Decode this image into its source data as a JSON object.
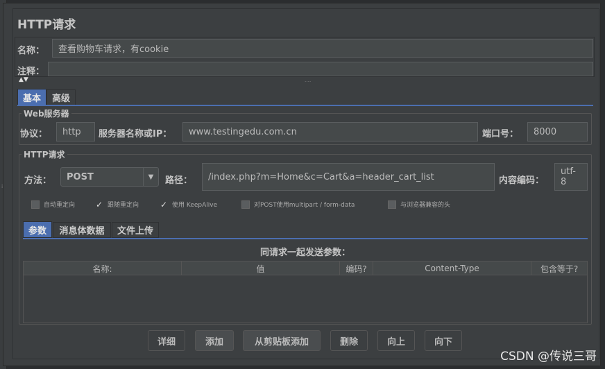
{
  "panel_title": "HTTP请求",
  "name_label": "名称：",
  "name_value": "查看购物车请求，有cookie",
  "comment_label": "注释：",
  "comment_value": "",
  "tabs": [
    {
      "label": "基本",
      "active": true
    },
    {
      "label": "高级",
      "active": false
    }
  ],
  "web_server": {
    "group_label": "Web服务器",
    "protocol_label": "协议：",
    "protocol_value": "http",
    "server_label": "服务器名称或IP：",
    "server_value": "www.testingedu.com.cn",
    "port_label": "端口号：",
    "port_value": "8000"
  },
  "http_request": {
    "group_label": "HTTP请求",
    "method_label": "方法：",
    "method_value": "POST",
    "path_label": "路径：",
    "path_value": "/index.php?m=Home&c=Cart&a=header_cart_list",
    "encoding_label": "内容编码：",
    "encoding_value": "utf-8"
  },
  "options": [
    {
      "label": "自动重定向",
      "checked": false
    },
    {
      "label": "跟随重定向",
      "checked": true
    },
    {
      "label": "使用 KeepAlive",
      "checked": true
    },
    {
      "label": "对POST使用multipart / form-data",
      "checked": false
    },
    {
      "label": "与浏览器兼容的头",
      "checked": false
    }
  ],
  "sub_tabs": [
    {
      "label": "参数",
      "active": true
    },
    {
      "label": "消息体数据",
      "active": false
    },
    {
      "label": "文件上传",
      "active": false
    }
  ],
  "params": {
    "caption": "同请求一起发送参数：",
    "columns": [
      "名称:",
      "值",
      "编码?",
      "Content-Type",
      "包含等于?"
    ]
  },
  "buttons": [
    "详细",
    "添加",
    "从剪贴板添加",
    "删除",
    "向上",
    "向下"
  ],
  "watermark": "CSDN @传说三哥"
}
